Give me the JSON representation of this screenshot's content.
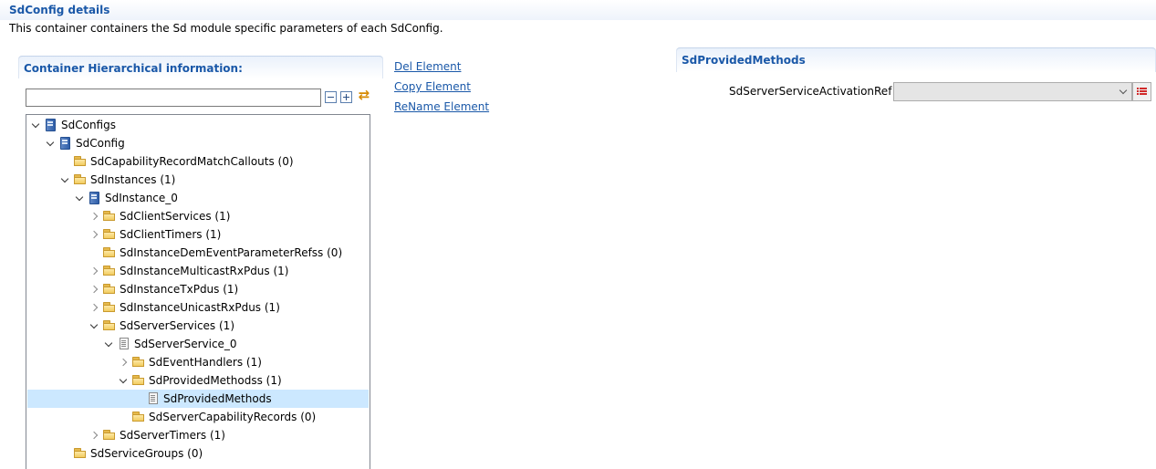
{
  "page": {
    "title": "SdConfig details",
    "description": "This container containers the Sd module specific parameters of each SdConfig."
  },
  "left_section": {
    "title": "Container Hierarchical information:",
    "filter": {
      "value": "",
      "placeholder": ""
    },
    "toolbar_icons": [
      "collapse-all-icon",
      "expand-all-icon",
      "sync-icon"
    ]
  },
  "tree": [
    {
      "label": "SdConfigs",
      "depth": 0,
      "twisty": "open",
      "icon": "module"
    },
    {
      "label": "SdConfig",
      "depth": 1,
      "twisty": "open",
      "icon": "module"
    },
    {
      "label": "SdCapabilityRecordMatchCallouts (0)",
      "depth": 2,
      "twisty": "none",
      "icon": "folder"
    },
    {
      "label": "SdInstances (1)",
      "depth": 2,
      "twisty": "open",
      "icon": "folder"
    },
    {
      "label": "SdInstance_0",
      "depth": 3,
      "twisty": "open",
      "icon": "module"
    },
    {
      "label": "SdClientServices (1)",
      "depth": 4,
      "twisty": "closed",
      "icon": "folder"
    },
    {
      "label": "SdClientTimers (1)",
      "depth": 4,
      "twisty": "closed",
      "icon": "folder"
    },
    {
      "label": "SdInstanceDemEventParameterRefss (0)",
      "depth": 4,
      "twisty": "none",
      "icon": "folder"
    },
    {
      "label": "SdInstanceMulticastRxPdus (1)",
      "depth": 4,
      "twisty": "closed",
      "icon": "folder"
    },
    {
      "label": "SdInstanceTxPdus (1)",
      "depth": 4,
      "twisty": "closed",
      "icon": "folder"
    },
    {
      "label": "SdInstanceUnicastRxPdus (1)",
      "depth": 4,
      "twisty": "closed",
      "icon": "folder"
    },
    {
      "label": "SdServerServices (1)",
      "depth": 4,
      "twisty": "open",
      "icon": "folder"
    },
    {
      "label": "SdServerService_0",
      "depth": 5,
      "twisty": "open",
      "icon": "doc"
    },
    {
      "label": "SdEventHandlers (1)",
      "depth": 6,
      "twisty": "closed",
      "icon": "folder"
    },
    {
      "label": "SdProvidedMethodss (1)",
      "depth": 6,
      "twisty": "open",
      "icon": "folder"
    },
    {
      "label": "SdProvidedMethods",
      "depth": 7,
      "twisty": "none",
      "icon": "doc",
      "selected": true
    },
    {
      "label": "SdServerCapabilityRecords (0)",
      "depth": 6,
      "twisty": "none",
      "icon": "folder"
    },
    {
      "label": "SdServerTimers (1)",
      "depth": 4,
      "twisty": "closed",
      "icon": "folder"
    },
    {
      "label": "SdServiceGroups (0)",
      "depth": 2,
      "twisty": "none",
      "icon": "folder"
    }
  ],
  "actions": {
    "del": "Del Element",
    "copy": "Copy Element",
    "rename": "ReName Element"
  },
  "right_section": {
    "title": "SdProvidedMethods",
    "field_label": "SdServerServiceActivationRef :",
    "field_value": ""
  },
  "colors": {
    "accent": "#1a58a8",
    "selection": "#cce8ff"
  }
}
